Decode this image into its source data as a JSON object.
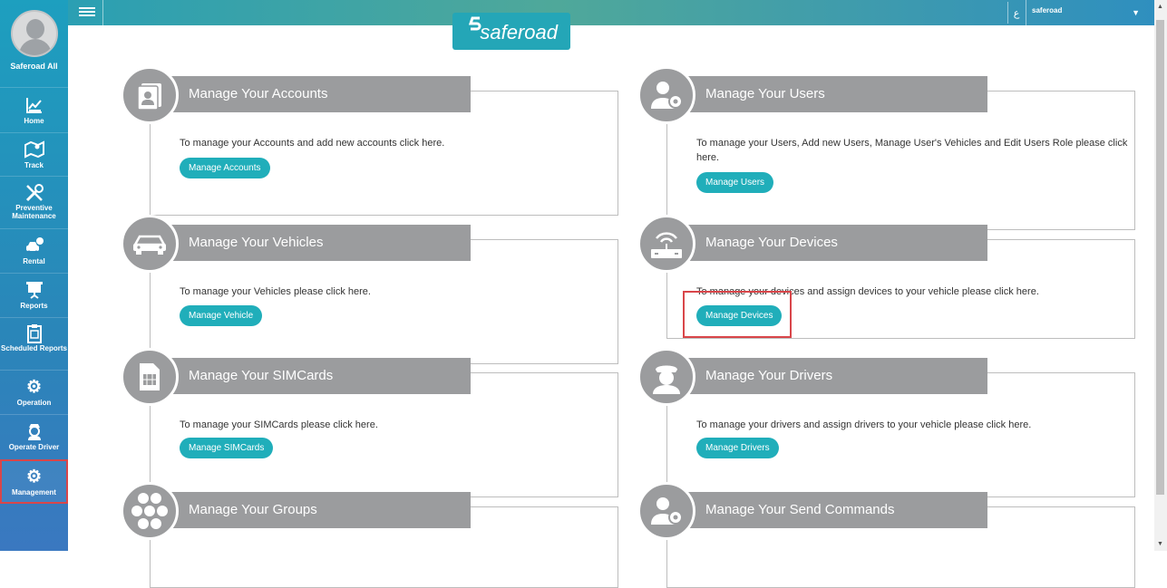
{
  "sidebar": {
    "user_name": "Saferoad All",
    "items": [
      {
        "label": "Home",
        "icon": "chart-icon"
      },
      {
        "label": "Track",
        "icon": "map-icon"
      },
      {
        "label": "Preventive Maintenance",
        "icon": "tools-icon"
      },
      {
        "label": "Rental",
        "icon": "car-rental-icon"
      },
      {
        "label": "Reports",
        "icon": "presentation-icon"
      },
      {
        "label": "Scheduled Reports",
        "icon": "clipboard-icon"
      },
      {
        "label": "Operation",
        "icon": "gears-icon"
      },
      {
        "label": "Operate Driver",
        "icon": "driver-icon"
      },
      {
        "label": "Management",
        "icon": "gears-icon"
      }
    ]
  },
  "topbar": {
    "logo_text": "saferoad",
    "lang_label": "ع",
    "user_label": "saferoad"
  },
  "cards": [
    {
      "title": "Manage Your Accounts",
      "desc": "To manage your Accounts and add new accounts click here.",
      "button": "Manage Accounts",
      "icon": "account-card-icon"
    },
    {
      "title": "Manage Your Users",
      "desc": "To manage your Users, Add new Users, Manage User's Vehicles and Edit Users Role please click here.",
      "button": "Manage Users",
      "icon": "user-gear-icon"
    },
    {
      "title": "Manage Your Vehicles",
      "desc": "To manage your Vehicles please click here.",
      "button": "Manage Vehicle",
      "icon": "car-icon"
    },
    {
      "title": "Manage Your Devices",
      "desc": "To manage your devices and assign devices to your vehicle please click here.",
      "button": "Manage Devices",
      "icon": "router-icon"
    },
    {
      "title": "Manage Your SIMCards",
      "desc": "To manage your SIMCards please click here.",
      "button": "Manage SIMCards",
      "icon": "simcard-icon"
    },
    {
      "title": "Manage Your Drivers",
      "desc": "To manage your drivers and assign drivers to your vehicle please click here.",
      "button": "Manage Drivers",
      "icon": "driver-icon"
    },
    {
      "title": "Manage Your Groups",
      "desc": "",
      "button": "",
      "icon": "hexagons-icon"
    },
    {
      "title": "Manage Your Send Commands",
      "desc": "",
      "button": "",
      "icon": "user-gear-icon"
    }
  ],
  "colors": {
    "accent": "#20aeba",
    "highlight": "#d9464a",
    "banner": "#9b9c9e"
  }
}
